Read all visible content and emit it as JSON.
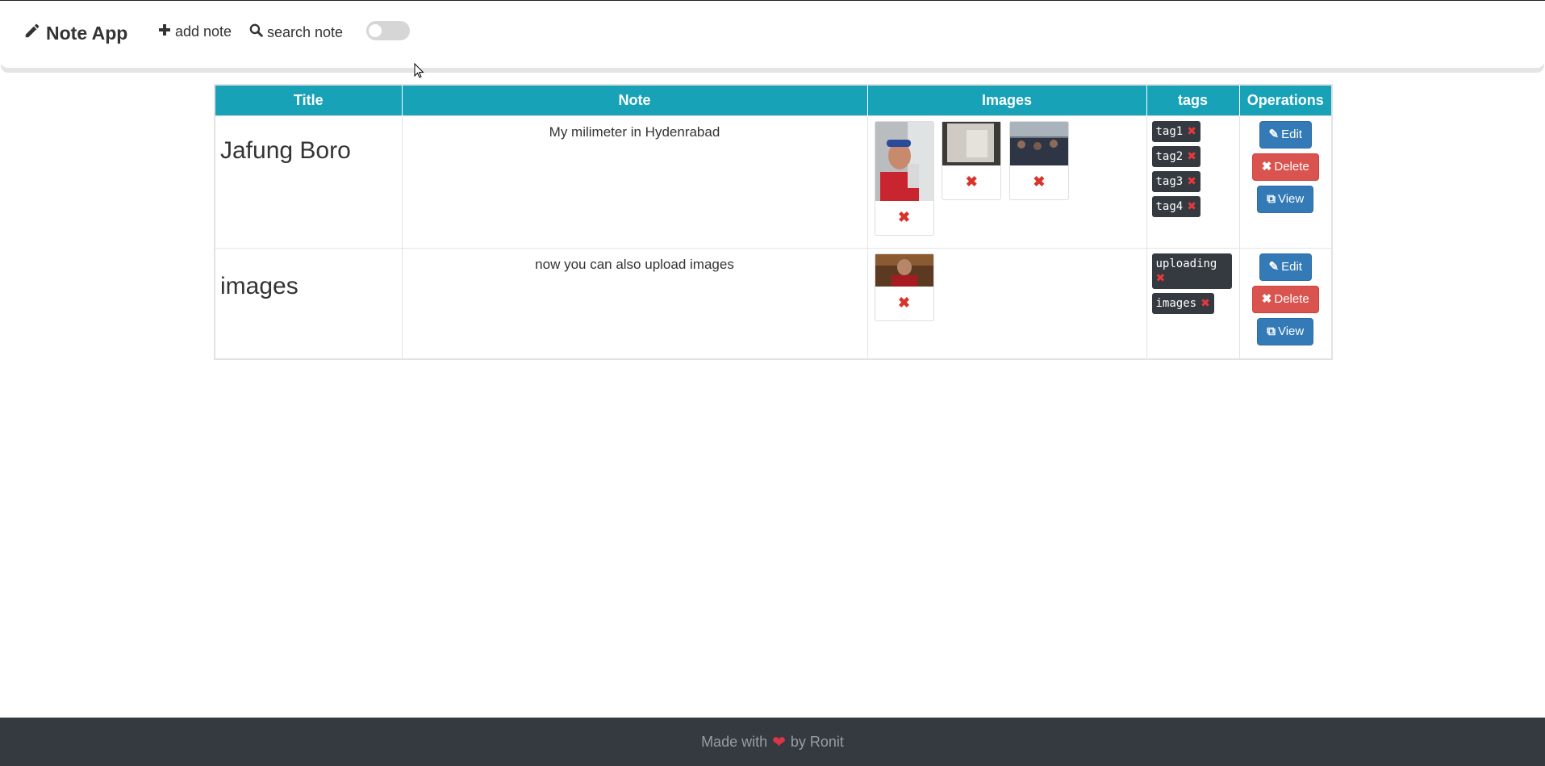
{
  "navbar": {
    "brand": "Note App",
    "add_note": "add note",
    "search_note": "search note",
    "dark_mode_toggle": "off"
  },
  "table": {
    "headers": [
      "Title",
      "Note",
      "Images",
      "tags",
      "Operations"
    ],
    "rows": [
      {
        "title": "Jafung Boro",
        "note": "My milimeter in Hydenrabad",
        "images": [
          "photo",
          "photo",
          "photo"
        ],
        "tags": [
          "tag1",
          "tag2",
          "tag3",
          "tag4"
        ]
      },
      {
        "title": "images",
        "note": "now you can also upload images",
        "images": [
          "photo"
        ],
        "tags": [
          "uploading",
          "images"
        ]
      }
    ],
    "operations": {
      "edit": "Edit",
      "delete": "Delete",
      "view": "View"
    }
  },
  "footer": {
    "made_with": "Made with",
    "by": "by Ronit"
  },
  "colors": {
    "header_bg": "#17a2b8",
    "edit_btn": "#337ab7",
    "delete_btn": "#d9534f",
    "tag_bg": "#343a40",
    "footer_bg": "#343a40"
  }
}
